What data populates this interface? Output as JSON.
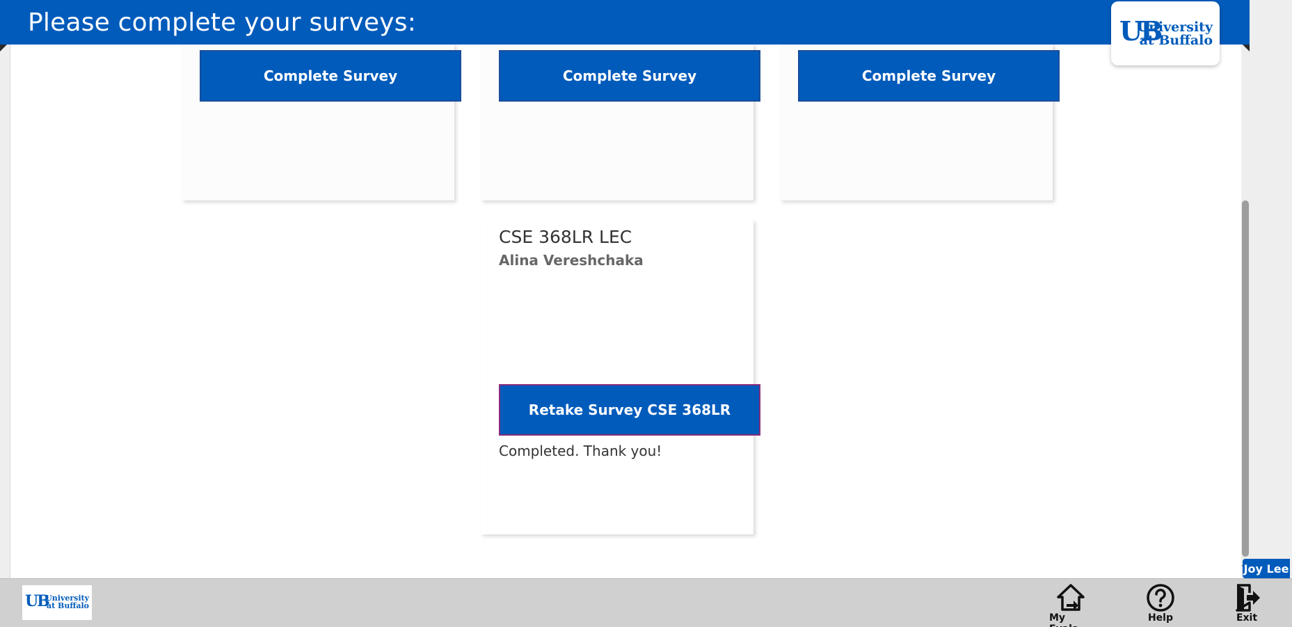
{
  "header": {
    "title": "Please complete your surveys:"
  },
  "logo": {
    "line1": "University",
    "line2": "at Buffalo",
    "mark": "UB"
  },
  "cards_top": [
    {
      "button_label": "Complete Survey"
    },
    {
      "button_label": "Complete Survey"
    },
    {
      "button_label": "Complete Survey"
    }
  ],
  "course_card": {
    "title": "CSE 368LR LEC",
    "instructor": "Alina Vereshchaka",
    "button_label": "Retake Survey CSE 368LR",
    "status": "Completed. Thank you!"
  },
  "user": {
    "name": "Joy Lee"
  },
  "footer": {
    "my_evals_label": "My Evals",
    "help_label": "Help",
    "exit_label": "Exit"
  },
  "colors": {
    "brand": "#005bbb",
    "footer_bg": "#d0d0d0"
  },
  "icons": {
    "home": "home-icon",
    "help": "help-icon",
    "exit": "exit-icon"
  }
}
